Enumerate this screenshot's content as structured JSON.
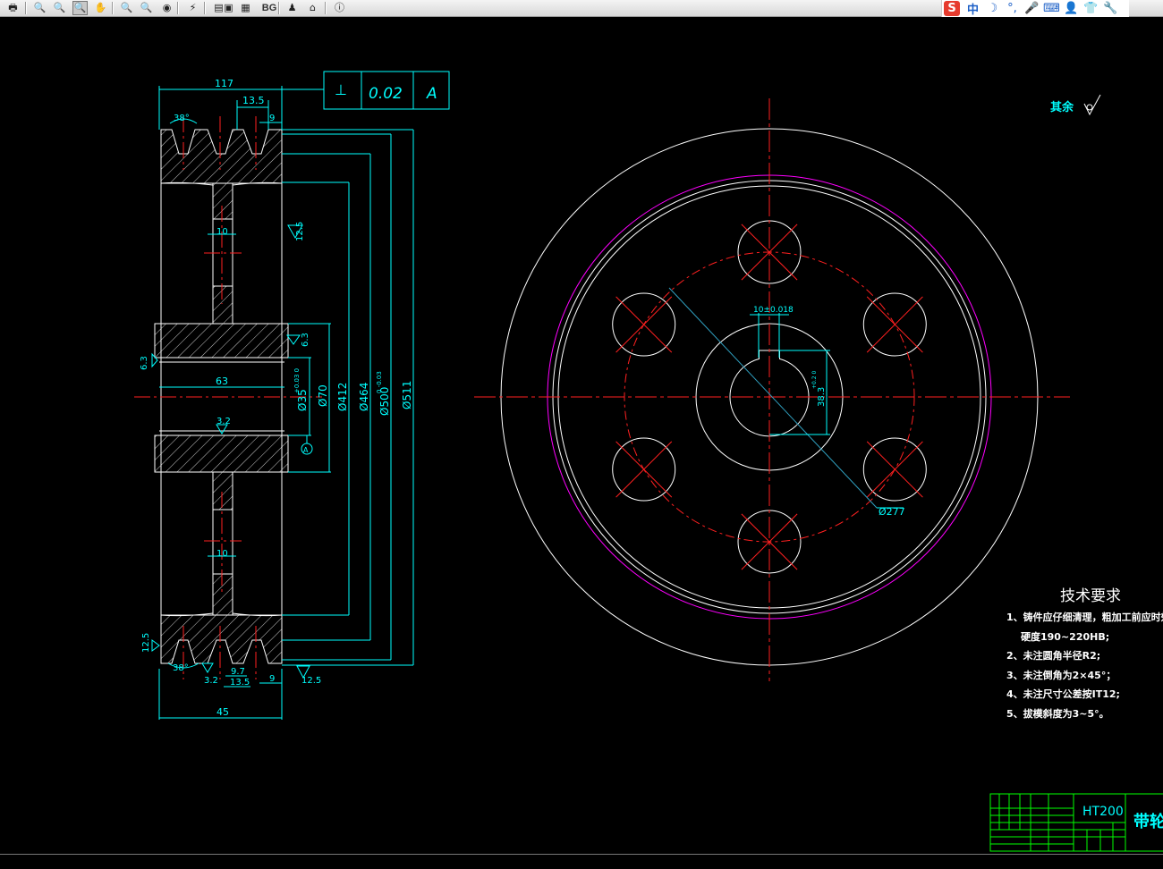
{
  "toolbar": {
    "tools": [
      {
        "name": "print-icon",
        "glyph": "🖶"
      },
      {
        "name": "zoom-out-icon",
        "glyph": "🔍"
      },
      {
        "name": "zoom-in-icon",
        "glyph": "🔍"
      },
      {
        "name": "zoom-window-icon",
        "glyph": "🔍"
      },
      {
        "name": "zoom-realtime-icon",
        "glyph": "✋"
      },
      {
        "name": "zoom-extents-icon",
        "glyph": "🔍"
      },
      {
        "name": "zoom-previous-icon",
        "glyph": "🔍"
      },
      {
        "name": "view-3d-icon",
        "glyph": "◉"
      },
      {
        "name": "pan-icon",
        "glyph": "⚡"
      },
      {
        "name": "layers-icon",
        "glyph": "▤"
      },
      {
        "name": "layout-icon",
        "glyph": "▦"
      },
      {
        "name": "background-icon",
        "glyph": "▣"
      },
      {
        "name": "user-icon",
        "glyph": "♟"
      },
      {
        "name": "home-icon",
        "glyph": "⌂"
      },
      {
        "name": "info-icon",
        "glyph": "ⓘ"
      }
    ],
    "bg_label": "BG"
  },
  "ime": {
    "logo": "S",
    "mode": "中",
    "items": [
      "☽",
      "°,",
      "🎤",
      "⌨",
      "👤",
      "👕",
      "🔧"
    ]
  },
  "colors": {
    "background": "#000000",
    "outline": "#ffffff",
    "dimension": "#00ffff",
    "centerline": "#ff0000",
    "pitch_circle": "#ff00ff",
    "title_block": "#00ff00",
    "ime_logo": "#ee3322"
  },
  "drawing": {
    "top_width_dim": "117",
    "groove_pitch_dim": "13.5",
    "groove_angle_dim": "38°",
    "groove_edge_dim": "9",
    "tolerance_frame": {
      "symbol": "⊥",
      "value": "0.02",
      "datum": "A"
    },
    "web_thickness_dim": "10",
    "roughness_side": "12.5",
    "roughness_hub": "6.3",
    "roughness_left_hub": "6.3",
    "bore_length_dim": "63",
    "bore_roughness": "3.2",
    "datum_label": "A",
    "dia_bore": "Ø35",
    "dia_bore_tol": "+0.03\n0",
    "dia_hub": "Ø70",
    "dia_rim_inner": "Ø412",
    "dia_rim_mid": "Ø464",
    "dia_pitch": "Ø500",
    "dia_pitch_tol": "0\n-0.03",
    "dia_outer": "Ø511",
    "bottom_angle_dim": "38°",
    "bottom_roughness_left": "3.2",
    "bottom_small_dim": "9.7",
    "bottom_pitch_dim": "13.5",
    "bottom_edge_dim": "9",
    "bottom_roughness_right": "12.5",
    "bottom_left_roughness": "12.5",
    "overall_width_dim": "45",
    "keyway_width_dim": "10±0.018",
    "keyway_depth_dim": "38.3",
    "keyway_depth_tol": "+0.2\n0",
    "hole_circle_dim": "Ø277",
    "other_surfaces": "其余"
  },
  "tech_requirements": {
    "title": "技术要求",
    "items": [
      "1、铸件应仔细清理，粗加工前应时效处",
      "硬度190~220HB;",
      "2、未注圆角半径R2;",
      "3、未注倒角为2×45°；",
      "4、未注尺寸公差按IT12;",
      "5、拔模斜度为3~5°。"
    ]
  },
  "title_block": {
    "material": "HT200",
    "name": "带轮"
  }
}
